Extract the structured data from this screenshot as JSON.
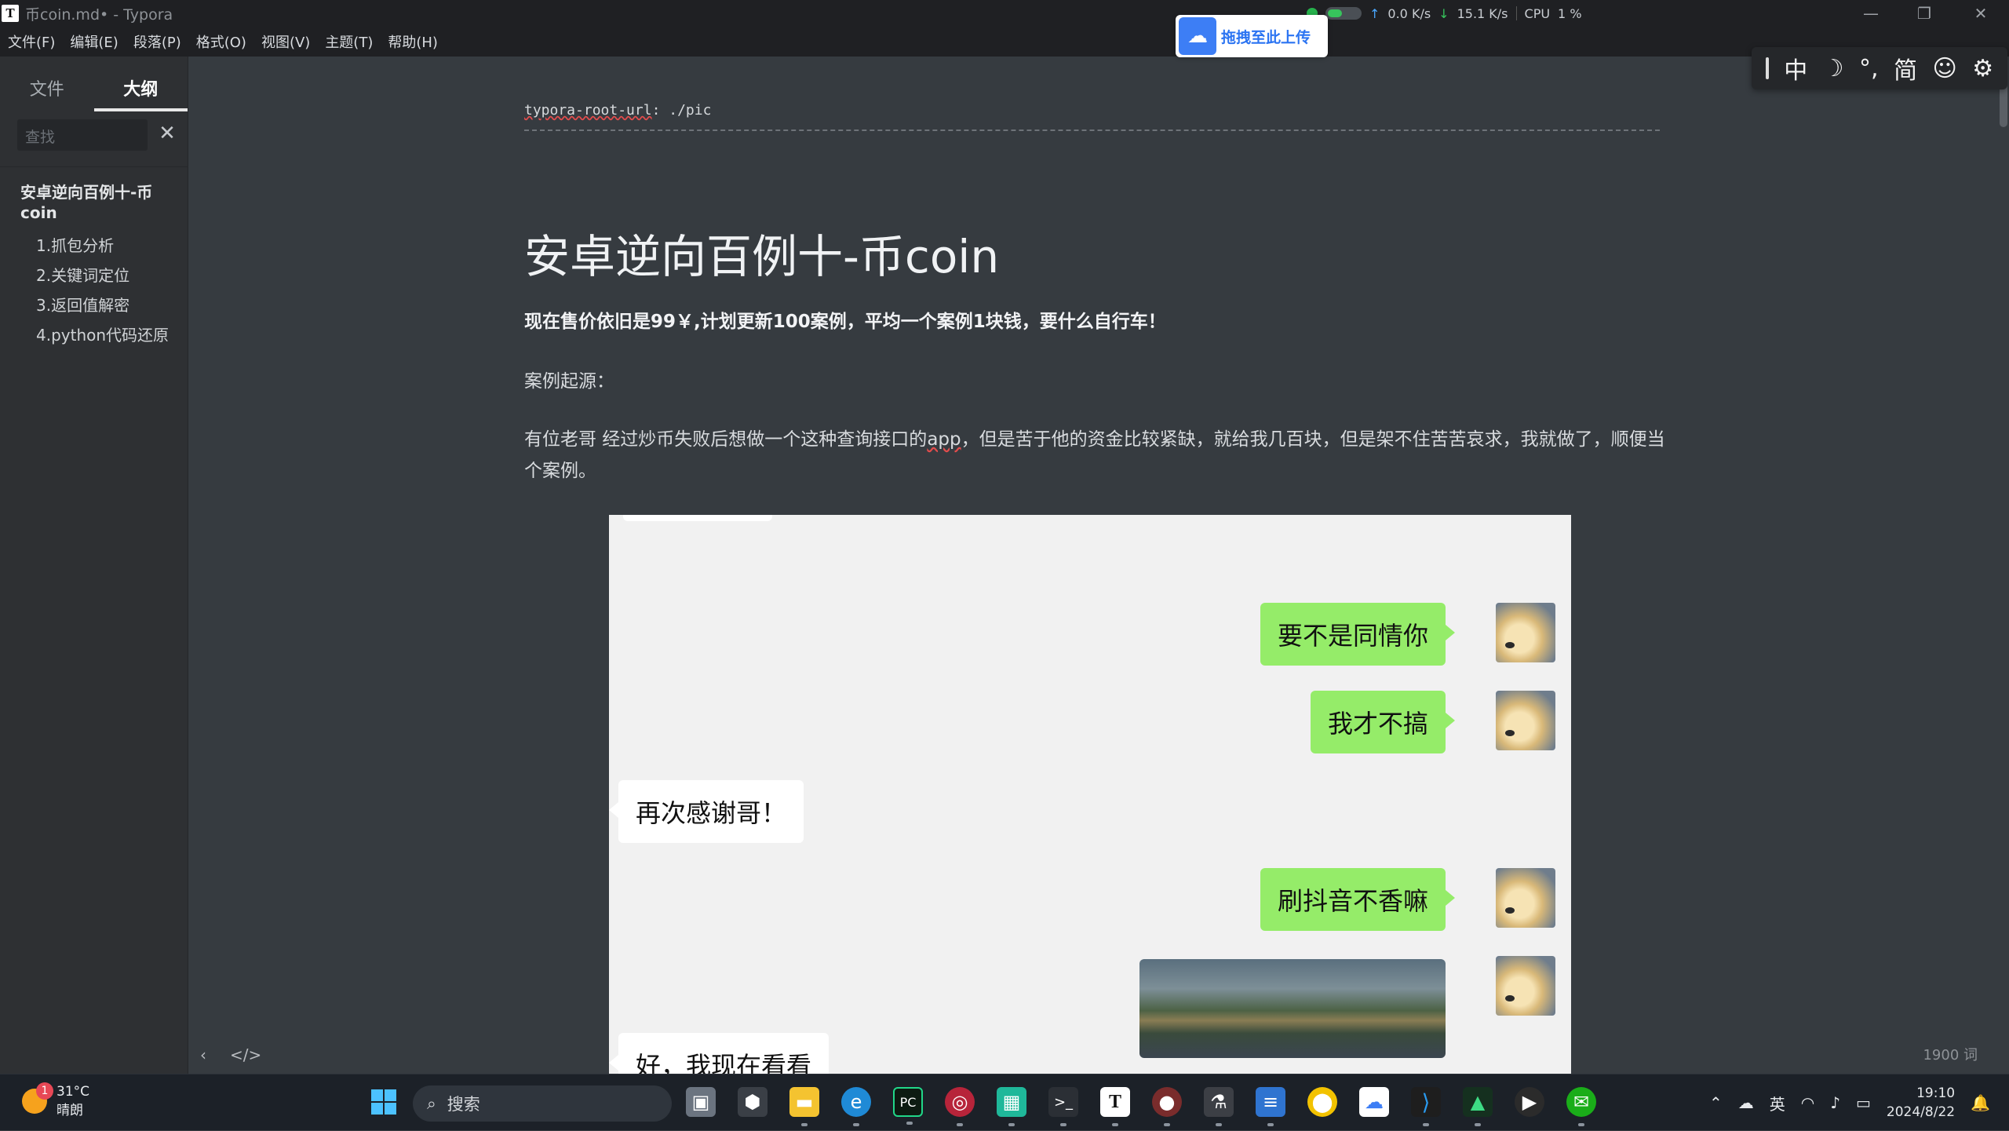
{
  "window": {
    "title": "币coin.md• - Typora",
    "app_icon": "T"
  },
  "upload_widget": {
    "label": "拖拽至此上传"
  },
  "netspeed": {
    "up": "0.0",
    "up_unit": "K/s",
    "down": "15.1",
    "down_unit": "K/s",
    "cpu_label": "CPU",
    "cpu_value": "1 %"
  },
  "menu": [
    "文件(F)",
    "编辑(E)",
    "段落(P)",
    "格式(O)",
    "视图(V)",
    "主题(T)",
    "帮助(H)"
  ],
  "sidebar": {
    "tabs": [
      "文件",
      "大纲"
    ],
    "active_tab": "大纲",
    "search_placeholder": "查找",
    "outline": {
      "h1": "安卓逆向百例十-币coin",
      "items": [
        "1.抓包分析",
        "2.关键词定位",
        "3.返回值解密",
        "4.python代码还原"
      ]
    }
  },
  "document": {
    "frontmatter_key": "typora-root-url",
    "frontmatter_value": ": ./pic",
    "title": "安卓逆向百例十-币coin",
    "bold_line": "现在售价依旧是99￥,计划更新100案例，平均一个案例1块钱，要什么自行车！",
    "origin_label": "案例起源：",
    "story_prefix": "有位老哥 经过炒币失败后想做一个这种查询接口的",
    "story_app": "app",
    "story_suffix": "，但是苦于他的资金比较紧缺，就给我几百块，但是架不住苦苦哀求，我就做了，顺便当个案例。"
  },
  "chat": {
    "messages": [
      {
        "side": "me",
        "text": "要不是同情你"
      },
      {
        "side": "me",
        "text": "我才不搞"
      },
      {
        "side": "other",
        "text": "再次感谢哥！"
      },
      {
        "side": "me",
        "text": "刷抖音不香嘛"
      },
      {
        "side": "me",
        "type": "image"
      },
      {
        "side": "other",
        "text": "好，我现在看看"
      }
    ]
  },
  "editor_footer": {
    "word_count": "1900 词"
  },
  "ime_toolbar": {
    "items": [
      "中",
      "☽",
      "°,",
      "简",
      "☺",
      "⚙"
    ]
  },
  "taskbar": {
    "weather_temp": "31°C",
    "weather_desc": "晴朗",
    "weather_badge": "1",
    "search_placeholder": "搜索",
    "tray_lang": "英",
    "time": "19:10",
    "date": "2024/8/22"
  },
  "colors": {
    "editor_bg": "#363b40",
    "sidebar_bg": "#2e3033",
    "titlebar_bg": "#1f2023",
    "wechat_green": "#95ec69",
    "accent_blue": "#3d7ef5"
  }
}
